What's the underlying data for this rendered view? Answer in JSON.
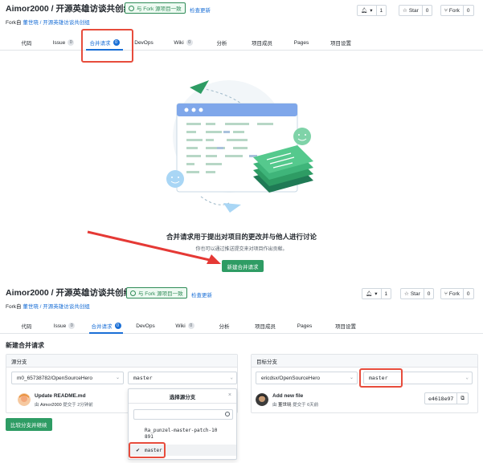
{
  "top": {
    "repo_title": "Aimor2000 / 开源英雄访谈共创组",
    "sync_badge": "与 Fork 源项目一致",
    "check_update": "检查更新",
    "fork_prefix": "Fork自",
    "fork_source": "董世晓 / 开源英雄访谈共创组",
    "watch_count": "1",
    "star_label": "Star",
    "star_count": "0",
    "fork_label": "Fork",
    "fork_count": "0",
    "tabs": [
      {
        "label": "代码"
      },
      {
        "label": "Issue",
        "count": "0"
      },
      {
        "label": "合并请求",
        "count": "0"
      },
      {
        "label": "DevOps"
      },
      {
        "label": "Wiki",
        "count": "0"
      },
      {
        "label": "分析"
      },
      {
        "label": "项目成员"
      },
      {
        "label": "Pages"
      },
      {
        "label": "项目设置"
      }
    ],
    "empty_title": "合并请求用于提出对项目的更改并与他人进行讨论",
    "empty_subtitle": "你也可以通过推送提交来对项目作出贡献。",
    "new_mr_button": "新建合并请求"
  },
  "bottom": {
    "repo_title": "Aimor2000 / 开源英雄访谈共创组",
    "sync_badge": "与 Fork 源项目一致",
    "check_update": "检查更新",
    "fork_prefix": "Fork自",
    "fork_source": "董世晓 / 开源英雄访谈共创组",
    "watch_count": "1",
    "star_label": "Star",
    "star_count": "0",
    "fork_label": "Fork",
    "fork_count": "0",
    "tabs": [
      {
        "label": "代码"
      },
      {
        "label": "Issue",
        "count": "0"
      },
      {
        "label": "合并请求",
        "count": "0"
      },
      {
        "label": "DevOps"
      },
      {
        "label": "Wiki",
        "count": "0"
      },
      {
        "label": "分析"
      },
      {
        "label": "项目成员"
      },
      {
        "label": "Pages"
      },
      {
        "label": "项目设置"
      }
    ]
  },
  "form": {
    "title": "新建合并请求",
    "source": {
      "header": "源分支",
      "project": "m0_65738782/OpenSourceHero",
      "branch": "master",
      "commit_title": "Update README.md",
      "commit_by": "由",
      "commit_author": "Aimor2000",
      "commit_time": "提交于 2分钟前"
    },
    "target": {
      "header": "目标分支",
      "project": "ericdsx/OpenSourceHero",
      "branch": "master",
      "commit_title": "Add new file",
      "commit_by": "由",
      "commit_author": "董世晓",
      "commit_time": "提交于 6天前",
      "sha": "e4618e97"
    },
    "compare_button": "比较分支并继续",
    "dropdown": {
      "title": "选择源分支",
      "items": [
        "Ra_punzel-master-patch-10",
        "891",
        "master"
      ]
    }
  },
  "colors": {
    "accent_blue": "#1a6fd6",
    "brand_green": "#2e9c64",
    "highlight_red": "#e74c3c"
  }
}
